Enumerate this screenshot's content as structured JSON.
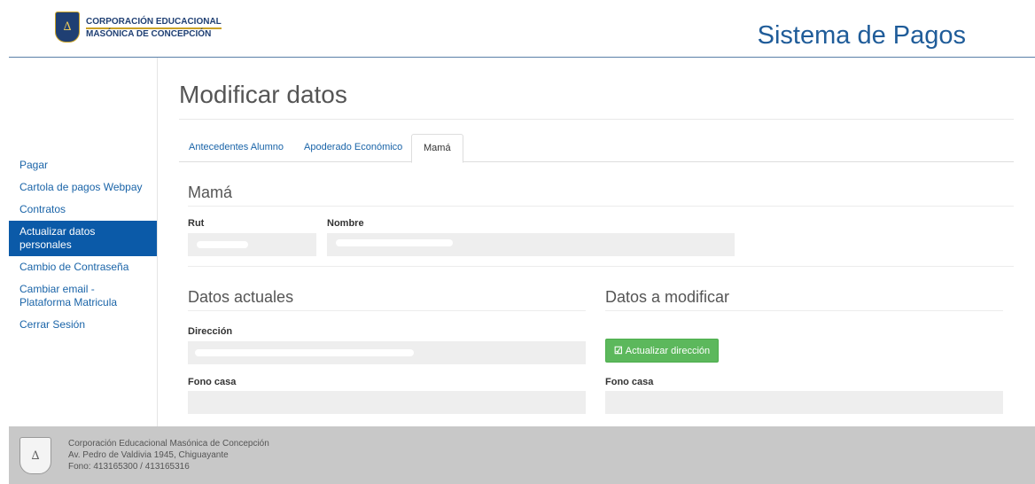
{
  "header": {
    "logo_line1": "CORPORACIÓN EDUCACIONAL",
    "logo_line2": "MASÓNICA DE CONCEPCIÓN",
    "app_title": "Sistema de Pagos"
  },
  "sidebar": {
    "items": [
      {
        "label": "Pagar"
      },
      {
        "label": "Cartola de pagos Webpay"
      },
      {
        "label": "Contratos"
      },
      {
        "label": "Actualizar datos personales",
        "active": true
      },
      {
        "label": "Cambio de Contraseña"
      },
      {
        "label": "Cambiar email - Plataforma Matricula"
      },
      {
        "label": "Cerrar Sesión"
      }
    ]
  },
  "main": {
    "title": "Modificar datos",
    "tabs": [
      "Antecedentes Alumno",
      "Apoderado Económico",
      "Mamá"
    ],
    "active_tab": "Mamá",
    "section_title": "Mamá",
    "rut_label": "Rut",
    "nombre_label": "Nombre",
    "current_title": "Datos actuales",
    "modify_title": "Datos a modificar",
    "direccion_label": "Dirección",
    "fono_casa_label": "Fono casa",
    "fono_casa_label_2": "Fono casa",
    "update_address_button": "Actualizar dirección",
    "update_icon": "edit-check-icon"
  },
  "footer": {
    "line1": "Corporación Educacional Masónica de Concepción",
    "line2": "Av. Pedro de Valdivia 1945, Chiguayante",
    "line3": "Fono: 413165300 / 413165316"
  },
  "colors": {
    "primary": "#0b5aa8",
    "link": "#1a64a8",
    "success": "#5cb85c",
    "footer_bg": "#c8c8c8"
  }
}
